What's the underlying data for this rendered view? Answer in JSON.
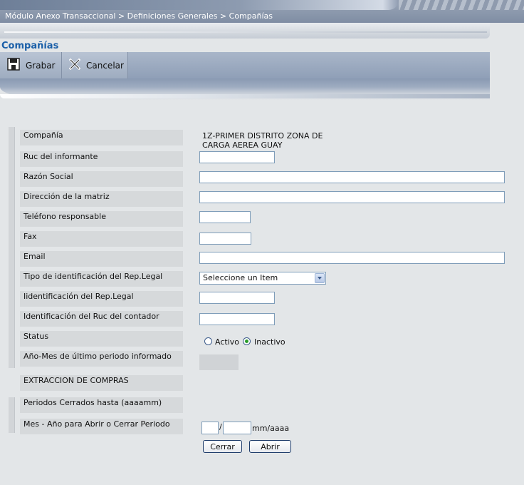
{
  "header": {
    "breadcrumb": "Módulo Anexo Transaccional > Definiciones Generales > Compañías",
    "page_title": "Compañías"
  },
  "toolbar": {
    "save_label": "Grabar",
    "save_icon": "save-icon",
    "cancel_label": "Cancelar",
    "cancel_icon": "close-icon"
  },
  "form": {
    "company_label": "Compañía",
    "company_value": "1Z-PRIMER DISTRITO ZONA DE CARGA AEREA GUAY",
    "ruc_label": "Ruc del informante",
    "ruc_value": "",
    "razon_label": "Razón Social",
    "razon_value": "",
    "direccion_label": "Dirección de la matriz",
    "direccion_value": "",
    "telefono_label": "Teléfono responsable",
    "telefono_value": "",
    "fax_label": "Fax",
    "fax_value": "",
    "email_label": "Email",
    "email_value": "",
    "tipo_id_label": "Tipo de identificación del Rep.Legal",
    "tipo_id_value": "Seleccione un Item",
    "id_rep_label": "Iidentificación del Rep.Legal",
    "id_rep_value": "",
    "id_contador_label": "Identificación del Ruc del contador",
    "id_contador_value": "",
    "status_label": "Status",
    "status_options": [
      "Activo",
      "Inactivo"
    ],
    "status_selected": "Inactivo",
    "ultimo_periodo_label": "Año-Mes de último periodo informado",
    "section_compras": "EXTRACCION DE COMPRAS",
    "periodos_cerrados_label": "Periodos Cerrados hasta (aaaamm)",
    "mes_anio_label": "Mes - Año para Abrir o Cerrar Periodo",
    "date_separator": "/",
    "date_format_hint": "mm/aaaa",
    "close_button": "Cerrar",
    "open_button": "Abrir"
  }
}
